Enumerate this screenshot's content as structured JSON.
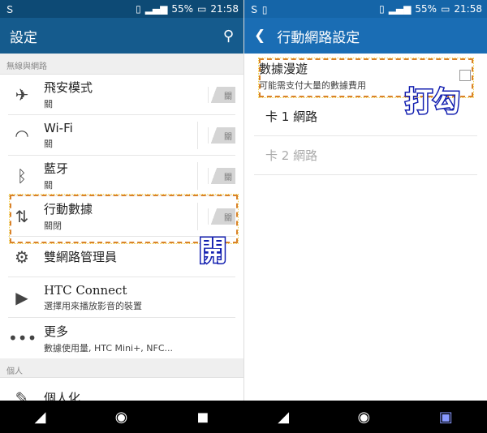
{
  "status": {
    "battery": "55%",
    "time": "21:58"
  },
  "left": {
    "title": "設定",
    "section_wireless": "無線與網路",
    "items": [
      {
        "icon": "airplane-icon",
        "label": "飛安模式",
        "sub": "關",
        "toggle": "關"
      },
      {
        "icon": "wifi-icon",
        "label": "Wi-Fi",
        "sub": "關",
        "toggle": "關"
      },
      {
        "icon": "bluetooth-icon",
        "label": "藍牙",
        "sub": "關",
        "toggle": "關"
      },
      {
        "icon": "mobile-data-icon",
        "label": "行動數據",
        "sub": "關閉",
        "toggle": "關"
      },
      {
        "icon": "sim-gear-icon",
        "label": "雙網路管理員"
      },
      {
        "icon": "htc-connect-icon",
        "label": "HTC Connect",
        "sub": "選擇用來播放影音的裝置"
      },
      {
        "icon": "more-icon",
        "label": "更多",
        "sub": "數據使用量, HTC Mini+, NFC..."
      }
    ],
    "section_personal": "個人",
    "personal_item": "個人化",
    "annotation": "開"
  },
  "right": {
    "title": "行動網路設定",
    "roaming": {
      "label": "數據漫遊",
      "sub": "可能需支付大量的數據費用",
      "checked": false
    },
    "sim1": "卡 1 網路",
    "sim2": "卡 2 網路",
    "annotation": "打勾"
  }
}
